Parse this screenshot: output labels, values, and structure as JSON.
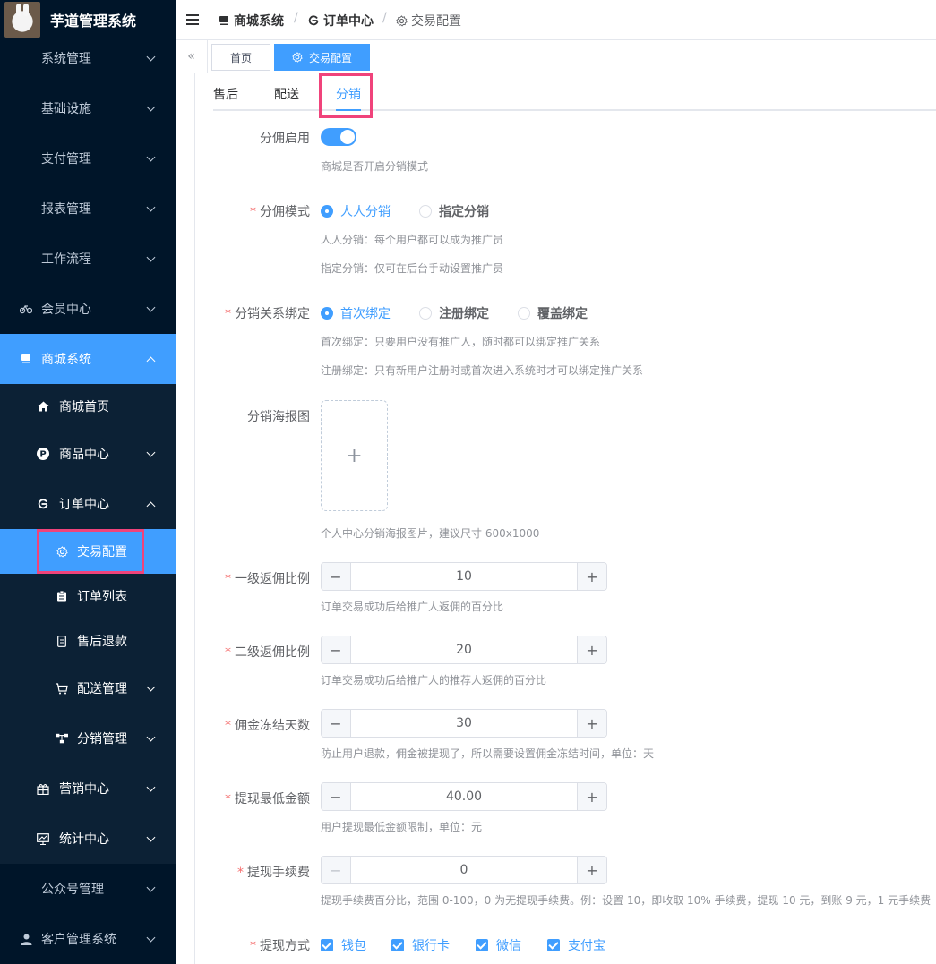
{
  "app": {
    "title": "芋道管理系统"
  },
  "sidebar": {
    "items": [
      {
        "label": "系统管理"
      },
      {
        "label": "基础设施"
      },
      {
        "label": "支付管理"
      },
      {
        "label": "报表管理"
      },
      {
        "label": "工作流程"
      },
      {
        "label": "会员中心"
      },
      {
        "label": "商城系统"
      },
      {
        "label": "商城首页"
      },
      {
        "label": "商品中心"
      },
      {
        "label": "订单中心"
      },
      {
        "label": "交易配置"
      },
      {
        "label": "订单列表"
      },
      {
        "label": "售后退款"
      },
      {
        "label": "配送管理"
      },
      {
        "label": "分销管理"
      },
      {
        "label": "营销中心"
      },
      {
        "label": "统计中心"
      },
      {
        "label": "公众号管理"
      },
      {
        "label": "客户管理系统"
      }
    ]
  },
  "breadcrumb": [
    "商城系统",
    "订单中心",
    "交易配置"
  ],
  "tags": {
    "home": "首页",
    "current": "交易配置"
  },
  "tabs": [
    "售后",
    "配送",
    "分销"
  ],
  "form": {
    "enable": {
      "label": "分佣启用",
      "hint": "商城是否开启分销模式",
      "value": true
    },
    "mode": {
      "label": "分佣模式",
      "options": [
        "人人分销",
        "指定分销"
      ],
      "selected": "人人分销",
      "hint1": "人人分销：每个用户都可以成为推广员",
      "hint2": "指定分销：仅可在后台手动设置推广员"
    },
    "bind": {
      "label": "分销关系绑定",
      "options": [
        "首次绑定",
        "注册绑定",
        "覆盖绑定"
      ],
      "selected": "首次绑定",
      "hint1": "首次绑定：只要用户没有推广人，随时都可以绑定推广关系",
      "hint2": "注册绑定：只有新用户注册时或首次进入系统时才可以绑定推广关系"
    },
    "poster": {
      "label": "分销海报图",
      "plus": "+",
      "hint": "个人中心分销海报图片，建议尺寸 600x1000"
    },
    "level1": {
      "label": "一级返佣比例",
      "value": "10",
      "hint": "订单交易成功后给推广人返佣的百分比"
    },
    "level2": {
      "label": "二级返佣比例",
      "value": "20",
      "hint": "订单交易成功后给推广人的推荐人返佣的百分比"
    },
    "frozen": {
      "label": "佣金冻结天数",
      "value": "30",
      "hint": "防止用户退款，佣金被提现了，所以需要设置佣金冻结时间，单位：天"
    },
    "min_withdraw": {
      "label": "提现最低金额",
      "value": "40.00",
      "hint": "用户提现最低金额限制，单位：元"
    },
    "fee": {
      "label": "提现手续费",
      "value": "0",
      "hint": "提现手续费百分比，范围 0-100，0 为无提现手续费。例：设置 10，即收取 10% 手续费，提现 10 元，到账 9 元，1 元手续费"
    },
    "methods": {
      "label": "提现方式",
      "options": [
        "钱包",
        "银行卡",
        "微信",
        "支付宝"
      ]
    }
  },
  "stepper": {
    "minus": "−",
    "plus": "+"
  },
  "colors": {
    "primary": "#409eff",
    "sidebar": "#001529",
    "highlight": "#f0437b",
    "required": "#f56c6c"
  }
}
